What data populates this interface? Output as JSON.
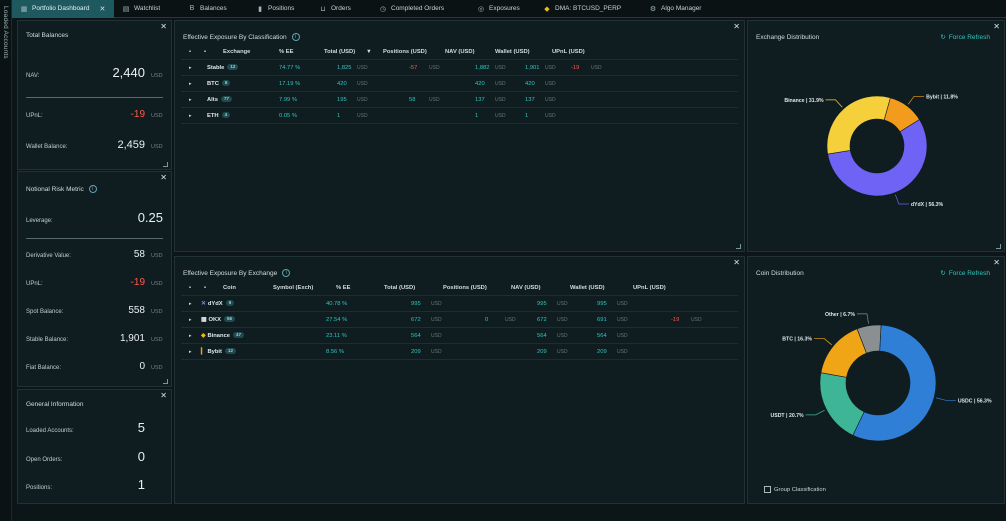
{
  "side": {
    "label": "Loaded Accounts"
  },
  "tabs": [
    {
      "label": "Portfolio Dashboard",
      "icon": "grid-icon",
      "active": true,
      "close": "✕"
    },
    {
      "label": "Watchlist",
      "icon": "list-icon"
    },
    {
      "label": "Balances",
      "icon": "b-icon"
    },
    {
      "label": "Positions",
      "icon": "bar-icon"
    },
    {
      "label": "Orders",
      "icon": "cart-icon"
    },
    {
      "label": "Completed Orders",
      "icon": "history-icon"
    },
    {
      "label": "Exposures",
      "icon": "globe-icon"
    },
    {
      "label": "DMA: BTCUSD_PERP",
      "icon": "binance-icon"
    },
    {
      "label": "Algo Manager",
      "icon": "algo-icon"
    }
  ],
  "total_balances": {
    "title": "Total Balances",
    "nav": {
      "label": "NAV:",
      "value": "2,440",
      "unit": "USD"
    },
    "upnl": {
      "label": "UPnL:",
      "value": "-19",
      "unit": "USD"
    },
    "wallet": {
      "label": "Wallet Balance:",
      "value": "2,459",
      "unit": "USD"
    }
  },
  "risk": {
    "title": "Notional Risk Metric",
    "leverage": {
      "label": "Leverage:",
      "value": "0.25"
    },
    "derivative": {
      "label": "Derivative Value:",
      "value": "58",
      "unit": "USD"
    },
    "upnl": {
      "label": "UPnL:",
      "value": "-19",
      "unit": "USD"
    },
    "spot": {
      "label": "Spot Balance:",
      "value": "558",
      "unit": "USD"
    },
    "stable": {
      "label": "Stable Balance:",
      "value": "1,901",
      "unit": "USD"
    },
    "fiat": {
      "label": "Fiat Balance:",
      "value": "0",
      "unit": "USD"
    }
  },
  "general": {
    "title": "General Information",
    "loaded": {
      "label": "Loaded Accounts:",
      "value": "5"
    },
    "open_orders": {
      "label": "Open Orders:",
      "value": "0"
    },
    "positions": {
      "label": "Positions:",
      "value": "1"
    }
  },
  "exp_class": {
    "title": "Effective Exposure By Classification",
    "headers": {
      "exchange": "Exchange",
      "ee": "% EE",
      "total": "Total (USD)",
      "sort": "▼",
      "positions": "Positions (USD)",
      "nav": "NAV (USD)",
      "wallet": "Wallet (USD)",
      "upnl": "UPnL (USD)"
    },
    "unit": "USD",
    "rows": [
      {
        "name": "Stable",
        "badge": "12",
        "ee": "74.77 %",
        "total": "1,825",
        "positions": "-57",
        "nav": "1,882",
        "wallet": "1,901",
        "upnl": "-19"
      },
      {
        "name": "BTC",
        "badge": "6",
        "ee": "17.19 %",
        "total": "420",
        "positions": "",
        "nav": "420",
        "wallet": "420",
        "upnl": ""
      },
      {
        "name": "Alts",
        "badge": "77",
        "ee": "7.99 %",
        "total": "195",
        "positions": "58",
        "nav": "137",
        "wallet": "137",
        "upnl": ""
      },
      {
        "name": "ETH",
        "badge": "4",
        "ee": "0.05 %",
        "total": "1",
        "positions": "",
        "nav": "1",
        "wallet": "1",
        "upnl": ""
      }
    ]
  },
  "exp_exchange": {
    "title": "Effective Exposure By Exchange",
    "headers": {
      "coin": "Coin",
      "symbol": "Symbol (Exch)",
      "ee": "% EE",
      "total": "Total (USD)",
      "positions": "Positions (USD)",
      "nav": "NAV (USD)",
      "wallet": "Wallet (USD)",
      "upnl": "UPnL (USD)"
    },
    "unit": "USD",
    "rows": [
      {
        "name": "dYdX",
        "badge": "6",
        "icon": "dydx-icon",
        "ee": "40.78 %",
        "total": "995",
        "positions": "",
        "nav": "995",
        "wallet": "995",
        "upnl": ""
      },
      {
        "name": "OKX",
        "badge": "56",
        "icon": "okx-icon",
        "ee": "27.54 %",
        "total": "672",
        "positions": "0",
        "nav": "672",
        "wallet": "691",
        "upnl": "-19"
      },
      {
        "name": "Binance",
        "badge": "47",
        "icon": "binance-icon",
        "ee": "23.11 %",
        "total": "564",
        "positions": "",
        "nav": "564",
        "wallet": "564",
        "upnl": ""
      },
      {
        "name": "Bybit",
        "badge": "12",
        "icon": "bybit-icon",
        "ee": "8.56 %",
        "total": "209",
        "positions": "",
        "nav": "209",
        "wallet": "209",
        "upnl": ""
      }
    ]
  },
  "exchange_dist": {
    "title": "Exchange Distribution",
    "refresh": "Force Refresh"
  },
  "coin_dist": {
    "title": "Coin Distribution",
    "refresh": "Force Refresh",
    "group_label": "Group Classification"
  },
  "chart_data": [
    {
      "type": "pie",
      "title": "Exchange Distribution",
      "slices": [
        {
          "label": "dYdX | 56.3%",
          "value": 56.3,
          "color": "#6e63f5"
        },
        {
          "label": "Binance | 31.9%",
          "value": 31.9,
          "color": "#f5d03a"
        },
        {
          "label": "Bybit | 11.8%",
          "value": 11.8,
          "color": "#f29b1d"
        }
      ]
    },
    {
      "type": "pie",
      "title": "Coin Distribution",
      "slices": [
        {
          "label": "USDC | 56.3%",
          "value": 56.3,
          "color": "#2f7fd6"
        },
        {
          "label": "USDT | 20.7%",
          "value": 20.7,
          "color": "#3fb598"
        },
        {
          "label": "BTC | 16.3%",
          "value": 16.3,
          "color": "#f0a516"
        },
        {
          "label": "Other | 6.7%",
          "value": 6.7,
          "color": "#8a8f92"
        }
      ]
    }
  ]
}
